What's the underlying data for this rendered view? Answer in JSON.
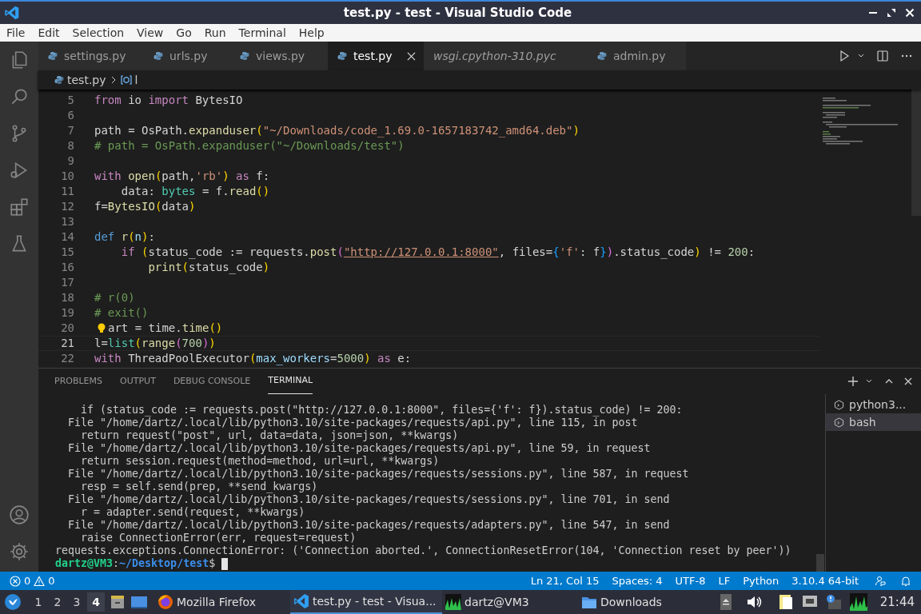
{
  "window": {
    "title": "test.py - test - Visual Studio Code"
  },
  "menu": [
    "File",
    "Edit",
    "Selection",
    "View",
    "Go",
    "Run",
    "Terminal",
    "Help"
  ],
  "tabs": [
    {
      "label": "settings.py",
      "kind": "python",
      "selected": false,
      "italic": false
    },
    {
      "label": "urls.py",
      "kind": "python",
      "selected": false,
      "italic": false
    },
    {
      "label": "views.py",
      "kind": "python",
      "selected": false,
      "italic": false
    },
    {
      "label": "test.py",
      "kind": "python",
      "selected": true,
      "italic": false
    },
    {
      "label": "wsgi.cpython-310.pyc",
      "kind": "binary",
      "selected": false,
      "italic": true
    },
    {
      "label": "admin.py",
      "kind": "python",
      "selected": false,
      "italic": false
    }
  ],
  "breadcrumb": {
    "file": "test.py",
    "symbol": "l"
  },
  "editor": {
    "lines": [
      {
        "number": "5",
        "current": false,
        "lightbulb": false,
        "tokens": [
          {
            "kind": "kw",
            "text": "from"
          },
          {
            "kind": "plain",
            "text": " io "
          },
          {
            "kind": "kw",
            "text": "import"
          },
          {
            "kind": "plain",
            "text": " BytesIO"
          }
        ]
      },
      {
        "number": "6",
        "current": false,
        "lightbulb": false
      },
      {
        "number": "7",
        "current": false,
        "lightbulb": false,
        "tokens": [
          {
            "kind": "plain",
            "text": "path = OsPath."
          },
          {
            "kind": "fn",
            "text": "expanduser"
          },
          {
            "kind": "br1",
            "text": "("
          },
          {
            "kind": "str",
            "text": "\"~/Downloads/code_1.69.0-1657183742_amd64.deb\""
          },
          {
            "kind": "br1",
            "text": ")"
          }
        ]
      },
      {
        "number": "8",
        "current": false,
        "lightbulb": false,
        "tokens": [
          {
            "kind": "comment",
            "text": "# path = OsPath.expanduser(\"~/Downloads/test\")"
          }
        ]
      },
      {
        "number": "9",
        "current": false,
        "lightbulb": false
      },
      {
        "number": "10",
        "current": false,
        "lightbulb": false,
        "tokens": [
          {
            "kind": "kw",
            "text": "with "
          },
          {
            "kind": "fn",
            "text": "open"
          },
          {
            "kind": "br1",
            "text": "("
          },
          {
            "kind": "plain",
            "text": "path,"
          },
          {
            "kind": "str",
            "text": "'rb'"
          },
          {
            "kind": "br1",
            "text": ")"
          },
          {
            "kind": "kw",
            "text": " as"
          },
          {
            "kind": "plain",
            "text": " f:"
          }
        ]
      },
      {
        "number": "11",
        "current": false,
        "lightbulb": false,
        "tokens": [
          {
            "kind": "plain",
            "text": "    data: "
          },
          {
            "kind": "type",
            "text": "bytes"
          },
          {
            "kind": "plain",
            "text": " = f."
          },
          {
            "kind": "fn",
            "text": "read"
          },
          {
            "kind": "br1",
            "text": "()"
          }
        ]
      },
      {
        "number": "12",
        "current": false,
        "lightbulb": false,
        "tokens": [
          {
            "kind": "plain",
            "text": "f="
          },
          {
            "kind": "fn",
            "text": "BytesIO"
          },
          {
            "kind": "br1",
            "text": "("
          },
          {
            "kind": "plain",
            "text": "data"
          },
          {
            "kind": "br1",
            "text": ")"
          }
        ]
      },
      {
        "number": "13",
        "current": false,
        "lightbulb": false
      },
      {
        "number": "14",
        "current": false,
        "lightbulb": false,
        "tokens": [
          {
            "kind": "def",
            "text": "def "
          },
          {
            "kind": "fn",
            "text": "r"
          },
          {
            "kind": "br1",
            "text": "("
          },
          {
            "kind": "var",
            "text": "n"
          },
          {
            "kind": "br1",
            "text": ")"
          },
          {
            "kind": "plain",
            "text": ":"
          }
        ]
      },
      {
        "number": "15",
        "current": false,
        "lightbulb": false,
        "tokens": [
          {
            "kind": "kw",
            "text": "    if "
          },
          {
            "kind": "br1",
            "text": "("
          },
          {
            "kind": "plain",
            "text": "status_code := requests."
          },
          {
            "kind": "fn",
            "text": "post"
          },
          {
            "kind": "br2",
            "text": "("
          },
          {
            "kind": "link",
            "text": "\"http://127.0.0.1:8000\""
          },
          {
            "kind": "plain",
            "text": ", files="
          },
          {
            "kind": "br3",
            "text": "{"
          },
          {
            "kind": "str",
            "text": "'f'"
          },
          {
            "kind": "plain",
            "text": ": f"
          },
          {
            "kind": "br3",
            "text": "}"
          },
          {
            "kind": "br2",
            "text": ")"
          },
          {
            "kind": "plain",
            "text": ".status_code"
          },
          {
            "kind": "br1",
            "text": ")"
          },
          {
            "kind": "plain",
            "text": " != "
          },
          {
            "kind": "num",
            "text": "200"
          },
          {
            "kind": "plain",
            "text": ":"
          }
        ]
      },
      {
        "number": "16",
        "current": false,
        "lightbulb": false,
        "tokens": [
          {
            "kind": "fn",
            "text": "        print"
          },
          {
            "kind": "br1",
            "text": "("
          },
          {
            "kind": "plain",
            "text": "status_code"
          },
          {
            "kind": "br1",
            "text": ")"
          }
        ]
      },
      {
        "number": "17",
        "current": false,
        "lightbulb": false
      },
      {
        "number": "18",
        "current": false,
        "lightbulb": false,
        "tokens": [
          {
            "kind": "comment",
            "text": "# r(0)"
          }
        ]
      },
      {
        "number": "19",
        "current": false,
        "lightbulb": false,
        "tokens": [
          {
            "kind": "comment",
            "text": "# exit()"
          }
        ]
      },
      {
        "number": "20",
        "current": false,
        "lightbulb": true,
        "tokens": [
          {
            "kind": "plain",
            "text": "art = time."
          },
          {
            "kind": "fn",
            "text": "time"
          },
          {
            "kind": "br1",
            "text": "()"
          }
        ]
      },
      {
        "number": "21",
        "current": true,
        "lightbulb": false,
        "tokens": [
          {
            "kind": "plain",
            "text": "l="
          },
          {
            "kind": "type",
            "text": "list"
          },
          {
            "kind": "br1",
            "text": "("
          },
          {
            "kind": "fn",
            "text": "range"
          },
          {
            "kind": "br2",
            "text": "("
          },
          {
            "kind": "num",
            "text": "700"
          },
          {
            "kind": "br2",
            "text": ")"
          },
          {
            "kind": "br1",
            "text": ")"
          }
        ]
      },
      {
        "number": "22",
        "current": false,
        "lightbulb": false,
        "tokens": [
          {
            "kind": "kw",
            "text": "with"
          },
          {
            "kind": "plain",
            "text": " ThreadPoolExecutor"
          },
          {
            "kind": "br1",
            "text": "("
          },
          {
            "kind": "var",
            "text": "max_workers"
          },
          {
            "kind": "plain",
            "text": "="
          },
          {
            "kind": "num",
            "text": "5000"
          },
          {
            "kind": "br1",
            "text": ")"
          },
          {
            "kind": "kw",
            "text": " as"
          },
          {
            "kind": "plain",
            "text": " e:"
          }
        ]
      }
    ]
  },
  "panel": {
    "tabs": [
      {
        "label": "PROBLEMS",
        "selected": false
      },
      {
        "label": "OUTPUT",
        "selected": false
      },
      {
        "label": "DEBUG CONSOLE",
        "selected": false
      },
      {
        "label": "TERMINAL",
        "selected": true
      }
    ],
    "terminal_lines": [
      "    if (status_code := requests.post(\"http://127.0.0.1:8000\", files={'f': f}).status_code) != 200:",
      "  File \"/home/dartz/.local/lib/python3.10/site-packages/requests/api.py\", line 115, in post",
      "    return request(\"post\", url, data=data, json=json, **kwargs)",
      "  File \"/home/dartz/.local/lib/python3.10/site-packages/requests/api.py\", line 59, in request",
      "    return session.request(method=method, url=url, **kwargs)",
      "  File \"/home/dartz/.local/lib/python3.10/site-packages/requests/sessions.py\", line 587, in request",
      "    resp = self.send(prep, **send_kwargs)",
      "  File \"/home/dartz/.local/lib/python3.10/site-packages/requests/sessions.py\", line 701, in send",
      "    r = adapter.send(request, **kwargs)",
      "  File \"/home/dartz/.local/lib/python3.10/site-packages/requests/adapters.py\", line 547, in send",
      "    raise ConnectionError(err, request=request)",
      "requests.exceptions.ConnectionError: ('Connection aborted.', ConnectionResetError(104, 'Connection reset by peer'))"
    ],
    "prompt": {
      "user": "dartz@VM3",
      "separator": ":",
      "path": "~/Desktop/test",
      "symbol": "$"
    },
    "sessions": [
      {
        "label": "python3...",
        "selected": false
      },
      {
        "label": "bash",
        "selected": true
      }
    ]
  },
  "status_bar": {
    "errors": "0",
    "warnings": "0",
    "items": [
      "Ln 21, Col 15",
      "Spaces: 4",
      "UTF-8",
      "LF",
      "Python",
      "3.10.4 64-bit"
    ]
  },
  "taskbar": {
    "workspaces": [
      {
        "label": "1",
        "selected": false
      },
      {
        "label": "2",
        "selected": false
      },
      {
        "label": "3",
        "selected": false
      },
      {
        "label": "4",
        "selected": true
      }
    ],
    "windows": [
      {
        "label": "Mozilla Firefox",
        "kind": "browser",
        "selected": false
      },
      {
        "label": "test.py - test - Visua...",
        "kind": "editor",
        "selected": true
      },
      {
        "label": "dartz@VM3",
        "kind": "terminal",
        "selected": false
      },
      {
        "label": "Downloads",
        "kind": "folder",
        "selected": false
      }
    ],
    "clock": "21:44"
  }
}
